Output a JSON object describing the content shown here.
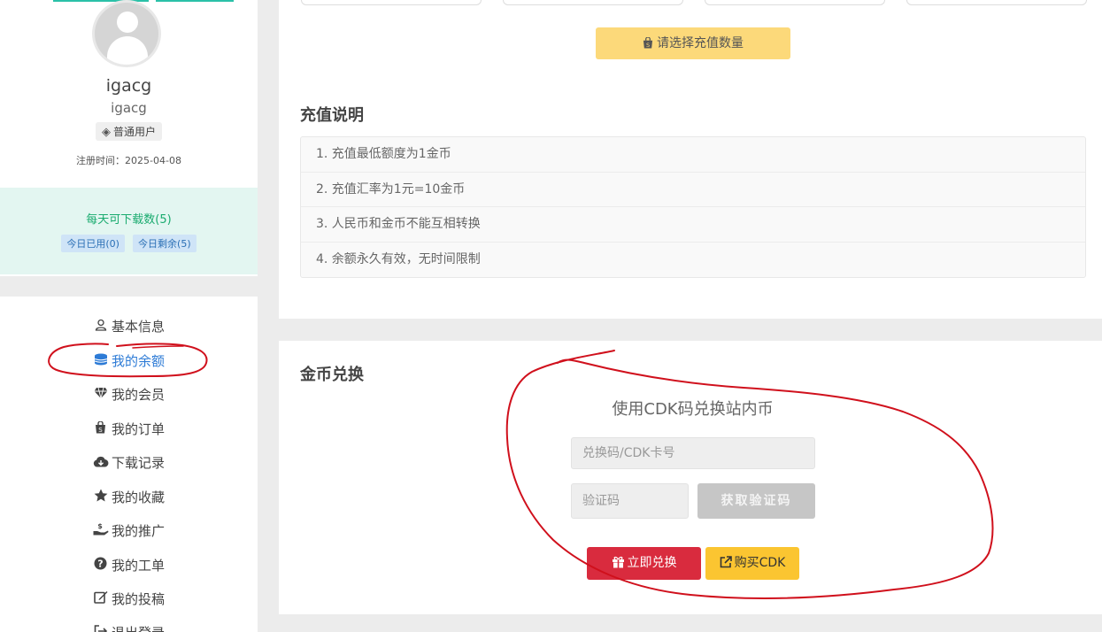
{
  "profile": {
    "username": "igacg",
    "user_id": "igacg",
    "role_badge": "普通用户",
    "register_date": "注册时间：2025-04-08",
    "avatar_icon": "user-avatar-icon"
  },
  "quota": {
    "title": "每天可下载数(5)",
    "used": "今日已用(0)",
    "remaining": "今日剩余(5)"
  },
  "menu": {
    "items": [
      {
        "label": "基本信息",
        "icon": "user-icon"
      },
      {
        "label": "我的余额",
        "icon": "coins-icon"
      },
      {
        "label": "我的会员",
        "icon": "diamond-icon"
      },
      {
        "label": "我的订单",
        "icon": "shopping-bag-icon"
      },
      {
        "label": "下载记录",
        "icon": "cloud-download-icon"
      },
      {
        "label": "我的收藏",
        "icon": "star-icon"
      },
      {
        "label": "我的推广",
        "icon": "hand-coin-icon"
      },
      {
        "label": "我的工单",
        "icon": "question-circle-icon"
      },
      {
        "label": "我的投稿",
        "icon": "edit-icon"
      },
      {
        "label": "退出登录",
        "icon": "sign-out-icon"
      }
    ],
    "active_index": 1
  },
  "recharge": {
    "select_button": "请选择充值数量",
    "notes_title": "充值说明",
    "notes": [
      "1. 充值最低额度为1金币",
      "2. 充值汇率为1元=10金币",
      "3. 人民币和金币不能互相转换",
      "4. 余额永久有效，无时间限制"
    ]
  },
  "exchange": {
    "title": "金币兑换",
    "subtitle": "使用CDK码兑换站内币",
    "cdk_placeholder": "兑换码/CDK卡号",
    "captcha_placeholder": "验证码",
    "get_code_label": "获取验证码",
    "redeem_label": "立即兑换",
    "buy_label": "购买CDK"
  },
  "colors": {
    "accent_blue": "#2d7bd6",
    "quota_green": "#1aab6f",
    "select_yellow": "#fcd97a",
    "redeem_red": "#d92b3e",
    "buy_yellow": "#fbc531",
    "annotation_red": "#d0101c"
  }
}
